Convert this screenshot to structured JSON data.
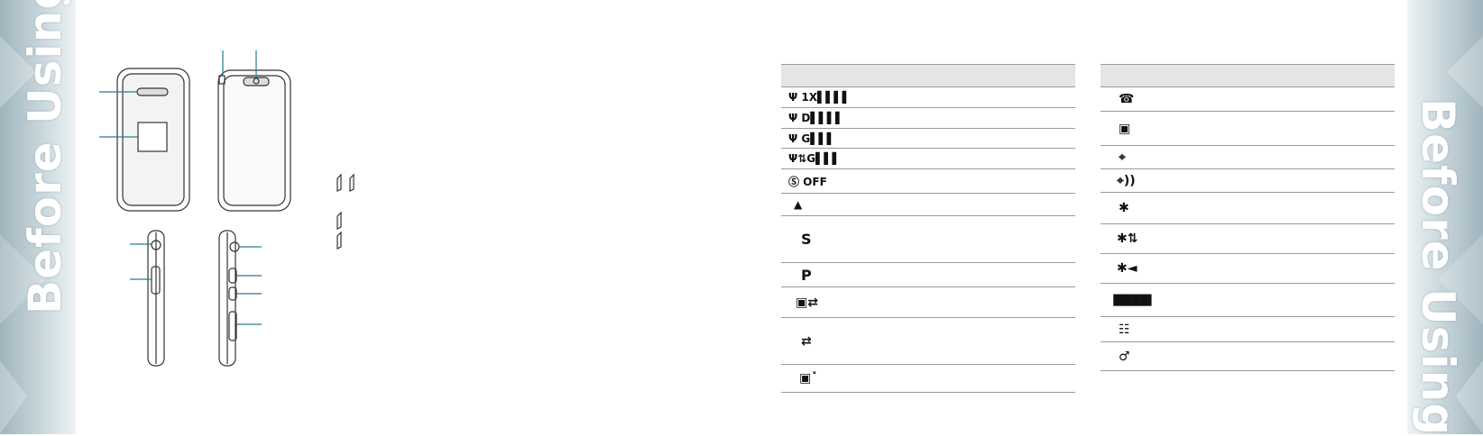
{
  "side_title": "Before Using",
  "colors": {
    "band": "#b7c8cf",
    "header": "#e3e5e7",
    "rule": "#9a9a9a"
  },
  "left_table": {
    "rows": [
      {
        "icon": "signal-1x-icon",
        "glyph": "Ψ 1X▌▌▌▌"
      },
      {
        "icon": "signal-d-icon",
        "glyph": "Ψ D▌▌▌▌"
      },
      {
        "icon": "signal-g-icon",
        "glyph": "Ψ G▌▌▌"
      },
      {
        "icon": "signal-g-transfer-icon",
        "glyph": "Ψ⇅G▌▌▌"
      },
      {
        "icon": "tty-off-icon",
        "glyph": "Ⓢ OFF"
      },
      {
        "icon": "roaming-triangle-icon",
        "glyph": "▲"
      },
      {
        "icon": "s-icon",
        "glyph": "S"
      },
      {
        "icon": "p-icon",
        "glyph": "P"
      },
      {
        "icon": "phone-transfer-icon",
        "glyph": "▣⇄"
      },
      {
        "icon": "transfer-icon",
        "glyph": "⇄"
      },
      {
        "icon": "phone-no-service-icon",
        "glyph": "▣˟"
      }
    ]
  },
  "right_table": {
    "rows": [
      {
        "icon": "tty-icon",
        "glyph": "☎"
      },
      {
        "icon": "handset-icon",
        "glyph": "▣"
      },
      {
        "icon": "location-icon",
        "glyph": "⌖"
      },
      {
        "icon": "location-signal-icon",
        "glyph": "⌖))"
      },
      {
        "icon": "bluetooth-icon",
        "glyph": "✱"
      },
      {
        "icon": "bluetooth-transfer-icon",
        "glyph": "✱⇅"
      },
      {
        "icon": "bluetooth-connected-icon",
        "glyph": "✱◄"
      },
      {
        "icon": "battery-icon",
        "glyph": "▐████▌"
      },
      {
        "icon": "message-icon",
        "glyph": "☷"
      },
      {
        "icon": "voice-icon",
        "glyph": "♂"
      }
    ]
  }
}
